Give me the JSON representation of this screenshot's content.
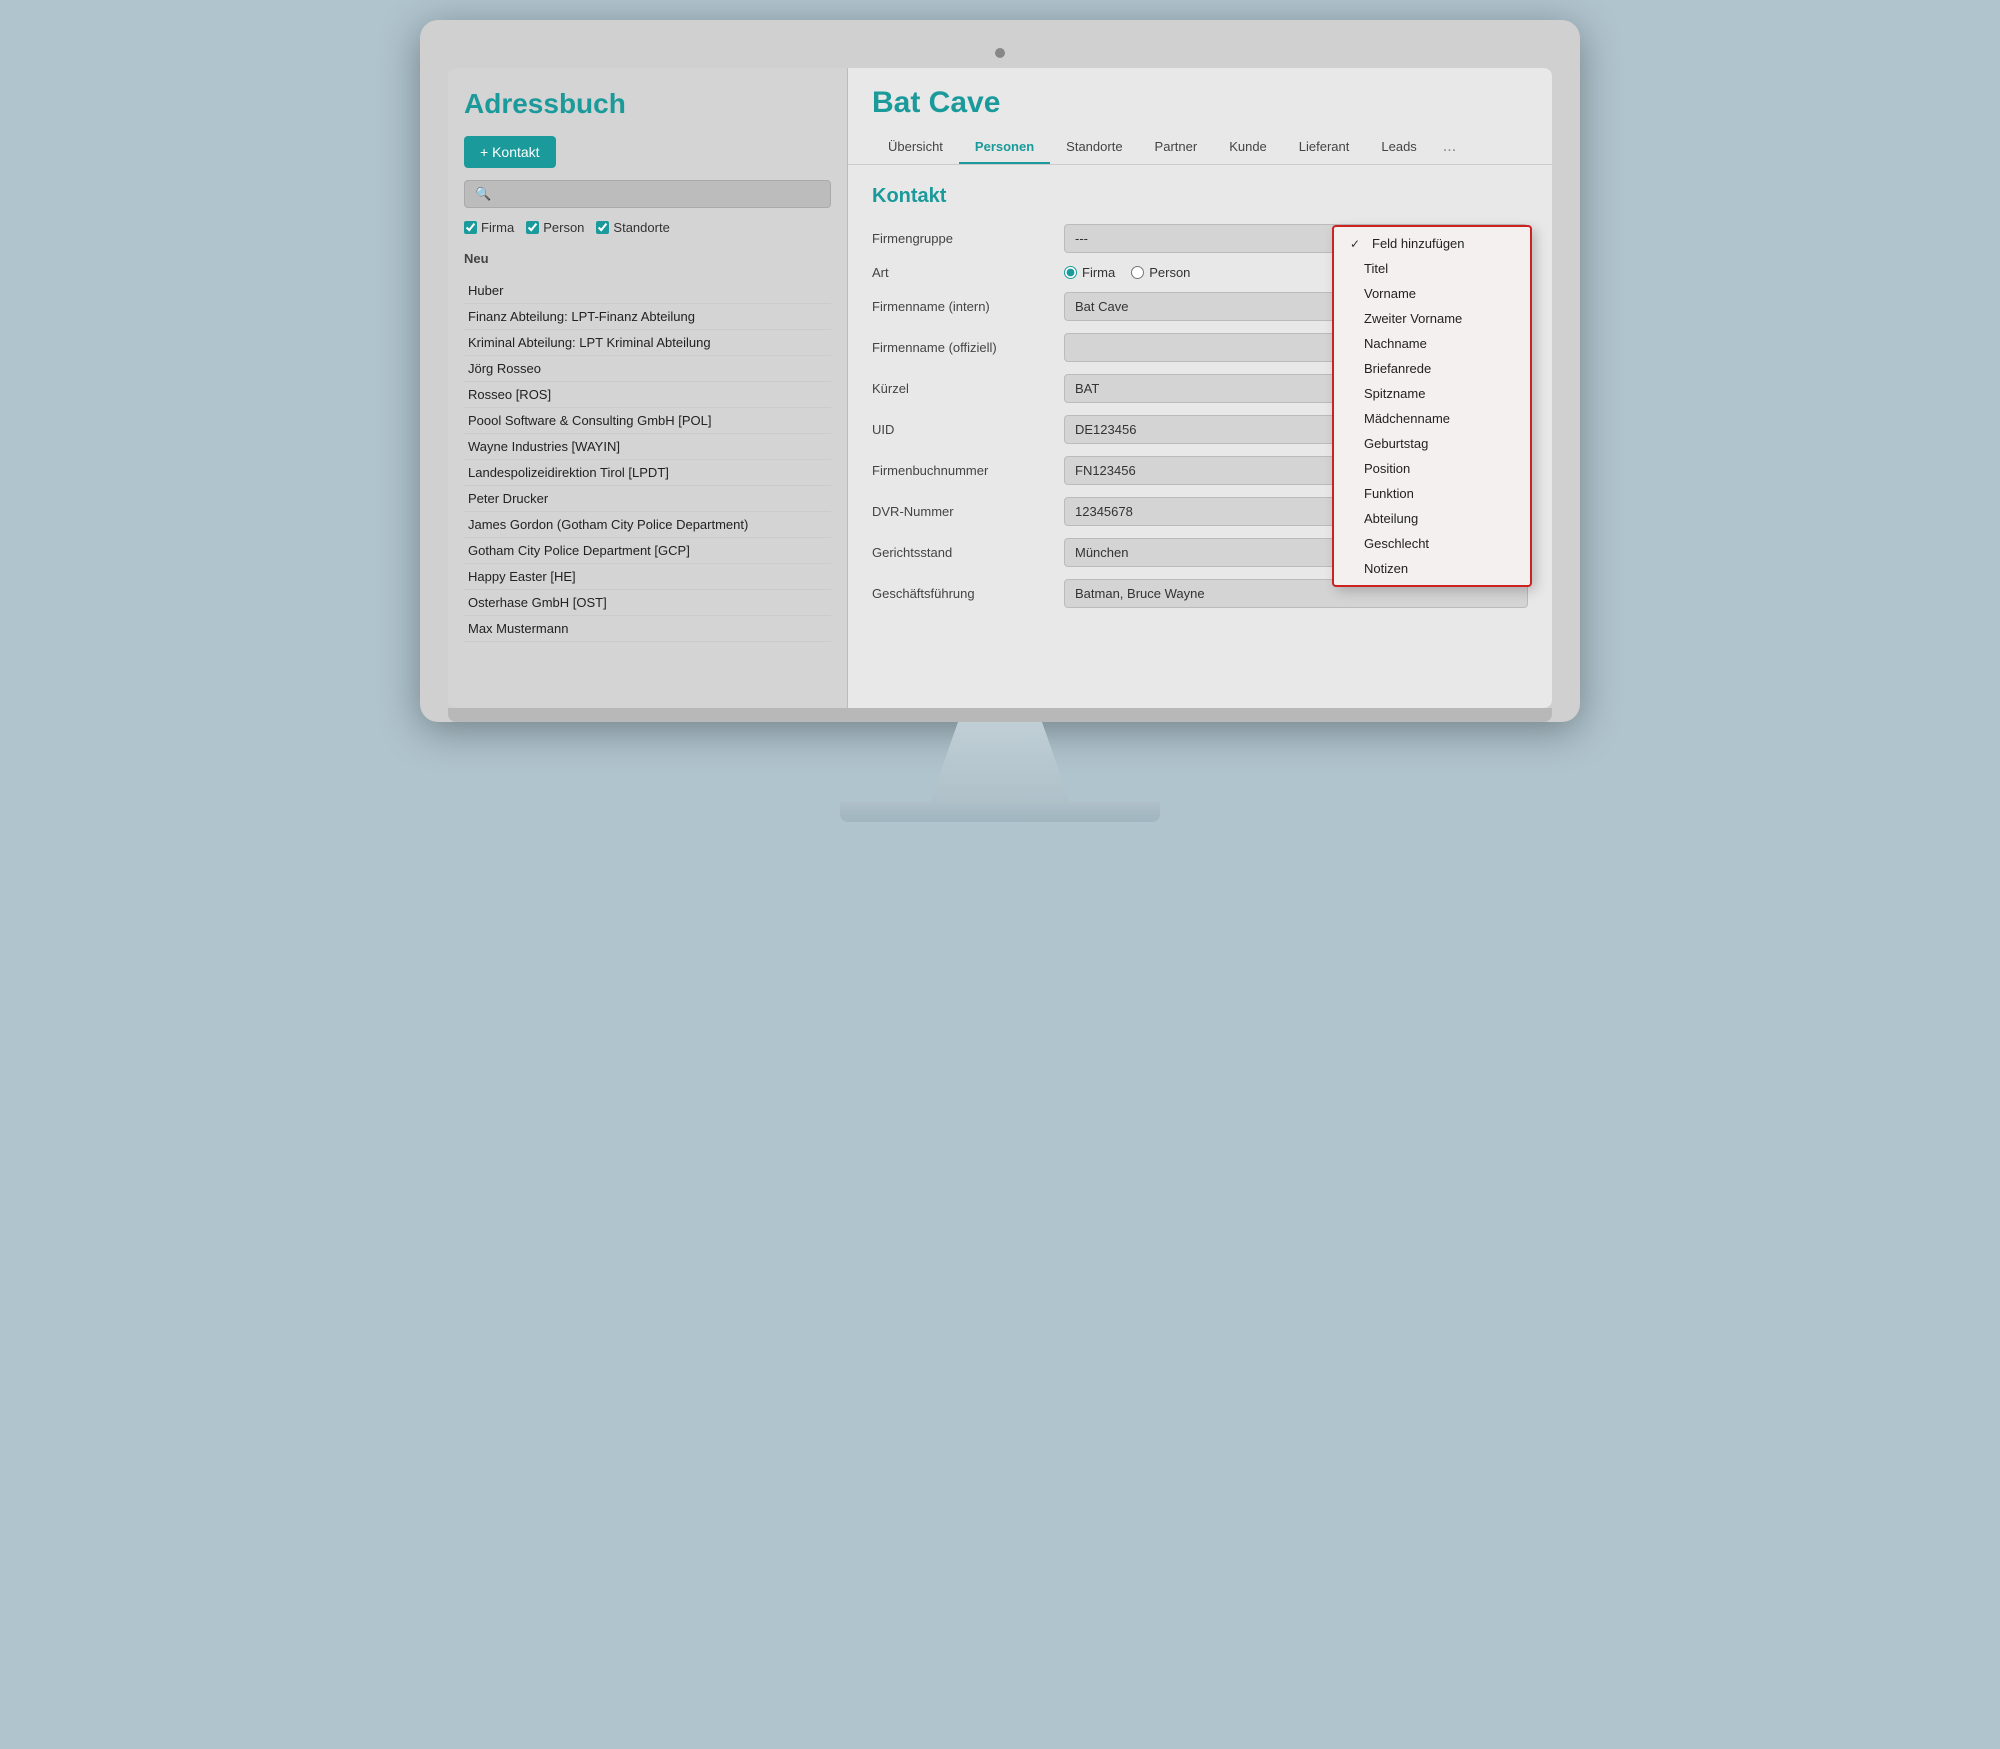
{
  "sidebar": {
    "title": "Adressbuch",
    "add_button": "+ Kontakt",
    "search_placeholder": "",
    "filters": [
      {
        "label": "Firma",
        "checked": true
      },
      {
        "label": "Person",
        "checked": true
      },
      {
        "label": "Standorte",
        "checked": true
      }
    ],
    "section_label": "Neu",
    "contacts": [
      {
        "name": "Huber"
      },
      {
        "name": "Finanz Abteilung: LPT-Finanz Abteilung"
      },
      {
        "name": "Kriminal Abteilung: LPT Kriminal Abteilung"
      },
      {
        "name": "Jörg Rosseo"
      },
      {
        "name": "Rosseo [ROS]"
      },
      {
        "name": "Poool Software & Consulting GmbH [POL]"
      },
      {
        "name": "Wayne Industries [WAYIN]"
      },
      {
        "name": "Landespolizeidirektion Tirol [LPDT]"
      },
      {
        "name": "Peter Drucker"
      },
      {
        "name": "James Gordon (Gotham City Police Department)"
      },
      {
        "name": "Gotham City Police Department [GCP]"
      },
      {
        "name": "Happy Easter [HE]"
      },
      {
        "name": "Osterhase GmbH [OST]"
      },
      {
        "name": "Max Mustermann"
      }
    ]
  },
  "main": {
    "page_title": "Bat Cave",
    "tabs": [
      {
        "label": "Übersicht",
        "active": false
      },
      {
        "label": "Personen",
        "active": true
      },
      {
        "label": "Standorte",
        "active": false
      },
      {
        "label": "Partner",
        "active": false
      },
      {
        "label": "Kunde",
        "active": false
      },
      {
        "label": "Lieferant",
        "active": false
      },
      {
        "label": "Leads",
        "active": false
      },
      {
        "label": "...",
        "active": false
      }
    ],
    "form_title": "Kontakt",
    "fields": [
      {
        "label": "Firmengruppe",
        "value": "---",
        "type": "text"
      },
      {
        "label": "Art",
        "value": "",
        "type": "radio",
        "options": [
          "Firma",
          "Person"
        ],
        "selected": "Firma"
      },
      {
        "label": "Firmenname (intern)",
        "value": "Bat Cave",
        "type": "text"
      },
      {
        "label": "Firmenname (offiziell)",
        "value": "",
        "type": "text"
      },
      {
        "label": "Kürzel",
        "value": "BAT",
        "type": "text"
      },
      {
        "label": "UID",
        "value": "DE123456",
        "type": "text"
      },
      {
        "label": "Firmenbuchnummer",
        "value": "FN123456",
        "type": "text"
      },
      {
        "label": "DVR-Nummer",
        "value": "12345678",
        "type": "text"
      },
      {
        "label": "Gerichtsstand",
        "value": "München",
        "type": "text"
      },
      {
        "label": "Geschäftsführung",
        "value": "Batman, Bruce Wayne",
        "type": "text"
      }
    ]
  },
  "dropdown": {
    "items": [
      {
        "label": "Feld hinzufügen",
        "checked": true
      },
      {
        "label": "Titel",
        "checked": false
      },
      {
        "label": "Vorname",
        "checked": false
      },
      {
        "label": "Zweiter Vorname",
        "checked": false
      },
      {
        "label": "Nachname",
        "checked": false
      },
      {
        "label": "Briefanrede",
        "checked": false
      },
      {
        "label": "Spitzname",
        "checked": false
      },
      {
        "label": "Mädchenname",
        "checked": false
      },
      {
        "label": "Geburtstag",
        "checked": false
      },
      {
        "label": "Position",
        "checked": false
      },
      {
        "label": "Funktion",
        "checked": false
      },
      {
        "label": "Abteilung",
        "checked": false
      },
      {
        "label": "Geschlecht",
        "checked": false
      },
      {
        "label": "Notizen",
        "checked": false
      }
    ]
  }
}
